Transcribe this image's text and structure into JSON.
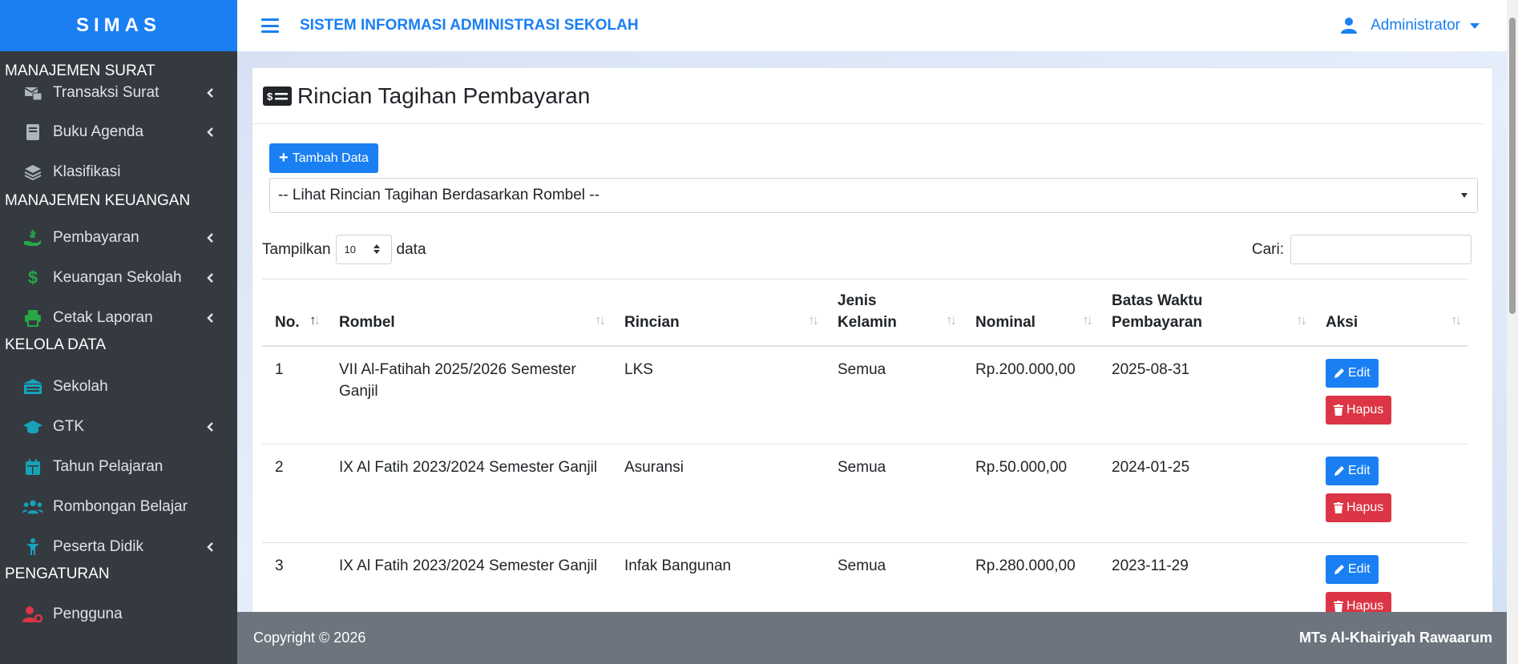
{
  "sidebar": {
    "brand": "SIMAS",
    "sections": [
      {
        "title": "MANAJEMEN SURAT",
        "items": [
          {
            "label": "Transaksi Surat",
            "icon": "mail-transfer-icon",
            "has_sub": true
          },
          {
            "label": "Buku Agenda",
            "icon": "book-icon",
            "has_sub": true
          },
          {
            "label": "Klasifikasi",
            "icon": "layers-icon",
            "has_sub": false
          }
        ]
      },
      {
        "title": "MANAJEMEN KEUANGAN",
        "items": [
          {
            "label": "Pembayaran",
            "icon": "hand-money-icon",
            "has_sub": true
          },
          {
            "label": "Keuangan Sekolah",
            "icon": "dollar-icon",
            "has_sub": true
          },
          {
            "label": "Cetak Laporan",
            "icon": "printer-icon",
            "has_sub": true
          }
        ]
      },
      {
        "title": "KELOLA DATA",
        "items": [
          {
            "label": "Sekolah",
            "icon": "school-icon",
            "has_sub": false
          },
          {
            "label": "GTK",
            "icon": "graduation-cap-icon",
            "has_sub": true
          },
          {
            "label": "Tahun Pelajaran",
            "icon": "calendar-icon",
            "has_sub": false
          },
          {
            "label": "Rombongan Belajar",
            "icon": "users-icon",
            "has_sub": false
          },
          {
            "label": "Peserta Didik",
            "icon": "child-icon",
            "has_sub": true
          }
        ]
      },
      {
        "title": "PENGATURAN",
        "items": [
          {
            "label": "Pengguna",
            "icon": "user-cog-icon",
            "has_sub": false
          }
        ]
      }
    ]
  },
  "topbar": {
    "title": "SISTEM INFORMASI ADMINISTRASI SEKOLAH",
    "user": "Administrator"
  },
  "page": {
    "title": "Rincian Tagihan Pembayaran",
    "add_button": "Tambah Data",
    "rombel_filter": "-- Lihat Rincian Tagihan Berdasarkan Rombel --",
    "length_prefix": "Tampilkan",
    "length_value": "10",
    "length_suffix": "data",
    "search_label": "Cari:",
    "search_value": ""
  },
  "table": {
    "columns": [
      "No.",
      "Rombel",
      "Rincian",
      "Jenis Kelamin",
      "Nominal",
      "Batas Waktu Pembayaran",
      "Aksi"
    ],
    "rows": [
      {
        "no": "1",
        "rombel": "VII Al-Fatihah 2025/2026 Semester Ganjil",
        "rincian": "LKS",
        "jk": "Semua",
        "nominal": "Rp.200.000,00",
        "batas": "2025-08-31"
      },
      {
        "no": "2",
        "rombel": "IX Al Fatih 2023/2024 Semester Ganjil",
        "rincian": "Asuransi",
        "jk": "Semua",
        "nominal": "Rp.50.000,00",
        "batas": "2024-01-25"
      },
      {
        "no": "3",
        "rombel": "IX Al Fatih 2023/2024 Semester Ganjil",
        "rincian": "Infak Bangunan",
        "jk": "Semua",
        "nominal": "Rp.280.000,00",
        "batas": "2023-11-29"
      }
    ],
    "edit_label": "Edit",
    "delete_label": "Hapus"
  },
  "footer": {
    "copyright": "Copyright © 2026",
    "school": "MTs Al-Khairiyah Rawaarum"
  },
  "colors": {
    "primary": "#1a7ff2",
    "sidebar": "#343a40",
    "danger": "#dc3545",
    "footer": "#6c757d"
  }
}
